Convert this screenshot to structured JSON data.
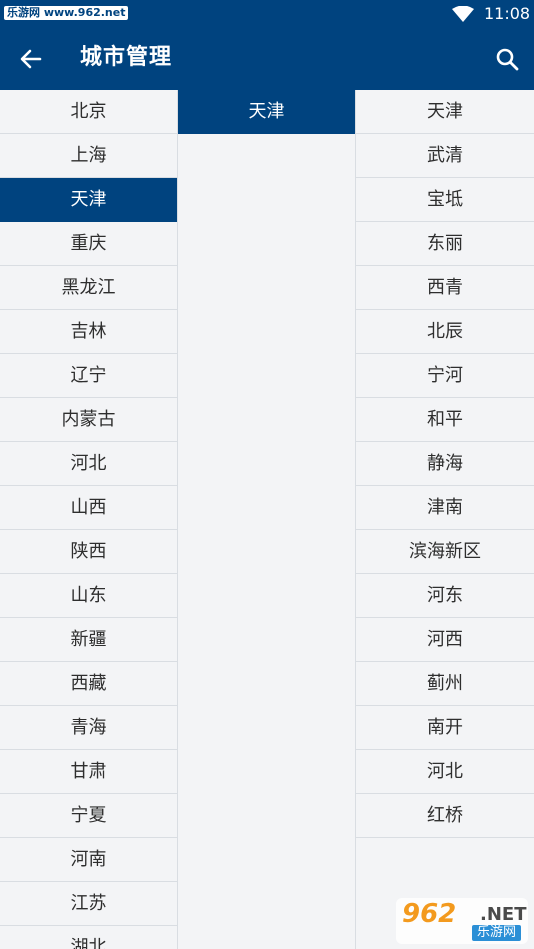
{
  "status_bar": {
    "watermark_text": "乐游网 www.962.net",
    "time": "11:08",
    "wifi_icon": "wifi-icon"
  },
  "app_bar": {
    "title": "城市管理",
    "back_icon": "arrow-left-icon",
    "search_icon": "search-icon"
  },
  "provinces": [
    {
      "label": "北京",
      "selected": false
    },
    {
      "label": "上海",
      "selected": false
    },
    {
      "label": "天津",
      "selected": true
    },
    {
      "label": "重庆",
      "selected": false
    },
    {
      "label": "黑龙江",
      "selected": false
    },
    {
      "label": "吉林",
      "selected": false
    },
    {
      "label": "辽宁",
      "selected": false
    },
    {
      "label": "内蒙古",
      "selected": false
    },
    {
      "label": "河北",
      "selected": false
    },
    {
      "label": "山西",
      "selected": false
    },
    {
      "label": "陕西",
      "selected": false
    },
    {
      "label": "山东",
      "selected": false
    },
    {
      "label": "新疆",
      "selected": false
    },
    {
      "label": "西藏",
      "selected": false
    },
    {
      "label": "青海",
      "selected": false
    },
    {
      "label": "甘肃",
      "selected": false
    },
    {
      "label": "宁夏",
      "selected": false
    },
    {
      "label": "河南",
      "selected": false
    },
    {
      "label": "江苏",
      "selected": false
    },
    {
      "label": "湖北",
      "selected": false
    }
  ],
  "cities": [
    {
      "label": "天津",
      "selected": true
    }
  ],
  "districts": [
    {
      "label": "天津"
    },
    {
      "label": "武清"
    },
    {
      "label": "宝坻"
    },
    {
      "label": "东丽"
    },
    {
      "label": "西青"
    },
    {
      "label": "北辰"
    },
    {
      "label": "宁河"
    },
    {
      "label": "和平"
    },
    {
      "label": "静海"
    },
    {
      "label": "津南"
    },
    {
      "label": "滨海新区"
    },
    {
      "label": "河东"
    },
    {
      "label": "河西"
    },
    {
      "label": "蓟州"
    },
    {
      "label": "南开"
    },
    {
      "label": "河北"
    },
    {
      "label": "红桥"
    }
  ],
  "watermark_logo": {
    "main": "962",
    "net": ".NET",
    "sub": "乐游网"
  },
  "colors": {
    "primary": "#00437f",
    "background": "#f3f4f6",
    "divider": "#d9dde2",
    "text": "#2e2e2e"
  }
}
